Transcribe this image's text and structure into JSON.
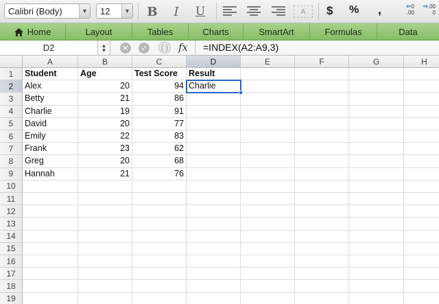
{
  "toolbar": {
    "font_name": "Calibri (Body)",
    "font_size": "12",
    "bold": "B",
    "italic": "I",
    "underline": "U",
    "wrap_text": "A",
    "currency": "$",
    "percent": "%",
    "comma": ",",
    "increase_decimal_top": "0",
    "increase_decimal_bottom": ".00",
    "decrease_decimal_top": ".00",
    "decrease_decimal_bottom": "0"
  },
  "ribbon": {
    "tabs": [
      {
        "label": "Home",
        "icon": "home-icon"
      },
      {
        "label": "Layout"
      },
      {
        "label": "Tables"
      },
      {
        "label": "Charts"
      },
      {
        "label": "SmartArt"
      },
      {
        "label": "Formulas"
      },
      {
        "label": "Data"
      }
    ],
    "accent_color": "#92c676"
  },
  "formula_bar": {
    "name_box": "D2",
    "fx_label": "fx",
    "formula": "=INDEX(A2:A9,3)"
  },
  "sheet": {
    "columns": [
      "A",
      "B",
      "C",
      "D",
      "E",
      "F",
      "G",
      "H"
    ],
    "active_column": "D",
    "active_row": "2",
    "active_cell": "D2",
    "selection_color": "#2a64c8",
    "row_numbers": [
      "1",
      "2",
      "3",
      "4",
      "5",
      "6",
      "7",
      "8",
      "9",
      "10",
      "11",
      "12",
      "13",
      "14",
      "15",
      "16",
      "17",
      "18",
      "19"
    ],
    "header_row": [
      "Student",
      "Age",
      "Test Score",
      "Result"
    ],
    "rows": [
      {
        "student": "Alex",
        "age": "20",
        "score": "94",
        "result": "Charlie"
      },
      {
        "student": "Betty",
        "age": "21",
        "score": "86",
        "result": ""
      },
      {
        "student": "Charlie",
        "age": "19",
        "score": "91",
        "result": ""
      },
      {
        "student": "David",
        "age": "20",
        "score": "77",
        "result": ""
      },
      {
        "student": "Emily",
        "age": "22",
        "score": "83",
        "result": ""
      },
      {
        "student": "Frank",
        "age": "23",
        "score": "62",
        "result": ""
      },
      {
        "student": "Greg",
        "age": "20",
        "score": "68",
        "result": ""
      },
      {
        "student": "Hannah",
        "age": "21",
        "score": "76",
        "result": ""
      }
    ]
  }
}
